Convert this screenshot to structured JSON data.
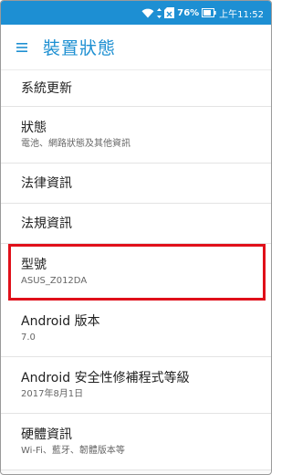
{
  "status_bar": {
    "icons": [
      "wifi-icon",
      "data-arrows-icon",
      "no-sim-icon",
      "battery-icon"
    ],
    "battery_percent": "76%",
    "time": "上午11:52",
    "color": "#1d8fd3"
  },
  "app_bar": {
    "menu_icon": "hamburger-menu-icon",
    "title": "裝置狀態",
    "accent_color": "#1e90d2"
  },
  "items": [
    {
      "title": "系統更新",
      "subtitle": ""
    },
    {
      "title": "狀態",
      "subtitle": "電池、網路狀態及其他資訊"
    },
    {
      "title": "法律資訊",
      "subtitle": ""
    },
    {
      "title": "法規資訊",
      "subtitle": ""
    },
    {
      "title": "型號",
      "subtitle": "ASUS_Z012DA"
    },
    {
      "title": "Android 版本",
      "subtitle": "7.0"
    },
    {
      "title": "Android 安全性修補程式等級",
      "subtitle": "2017年8月1日"
    },
    {
      "title": "硬體資訊",
      "subtitle": "Wi-Fi、藍牙、韌體版本等"
    }
  ]
}
